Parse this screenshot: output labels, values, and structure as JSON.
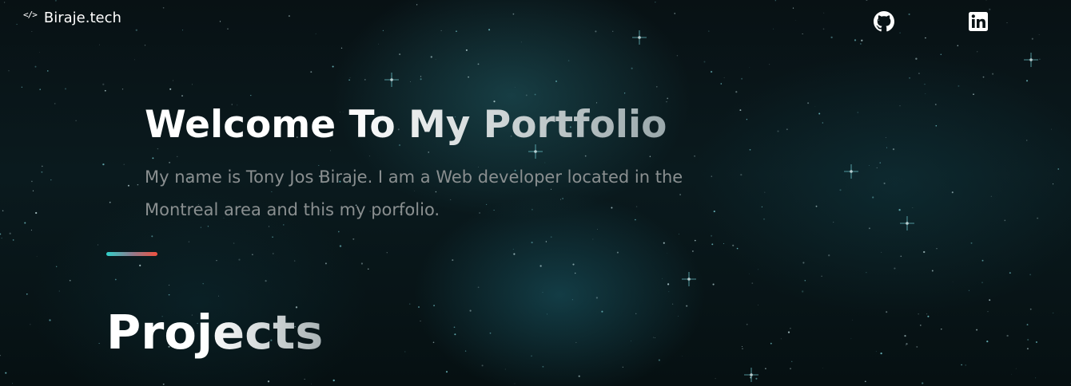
{
  "header": {
    "brand_icon": "</>",
    "brand_name": "Biraje.tech",
    "social": [
      {
        "icon": "github-icon"
      },
      {
        "icon": "linkedin-icon"
      }
    ]
  },
  "hero": {
    "title": "Welcome To My Portfolio",
    "intro": "My name is Tony Jos Biraje. I am a Web developer located in the Montreal area and this my porfolio."
  },
  "section": {
    "title": "Projects"
  },
  "colors": {
    "background": "#081114",
    "nebula": "#286e78",
    "text_primary": "#ffffff",
    "text_muted": "#8a8f90",
    "accent_start": "#2fd0c9",
    "accent_end": "#f0503e"
  }
}
